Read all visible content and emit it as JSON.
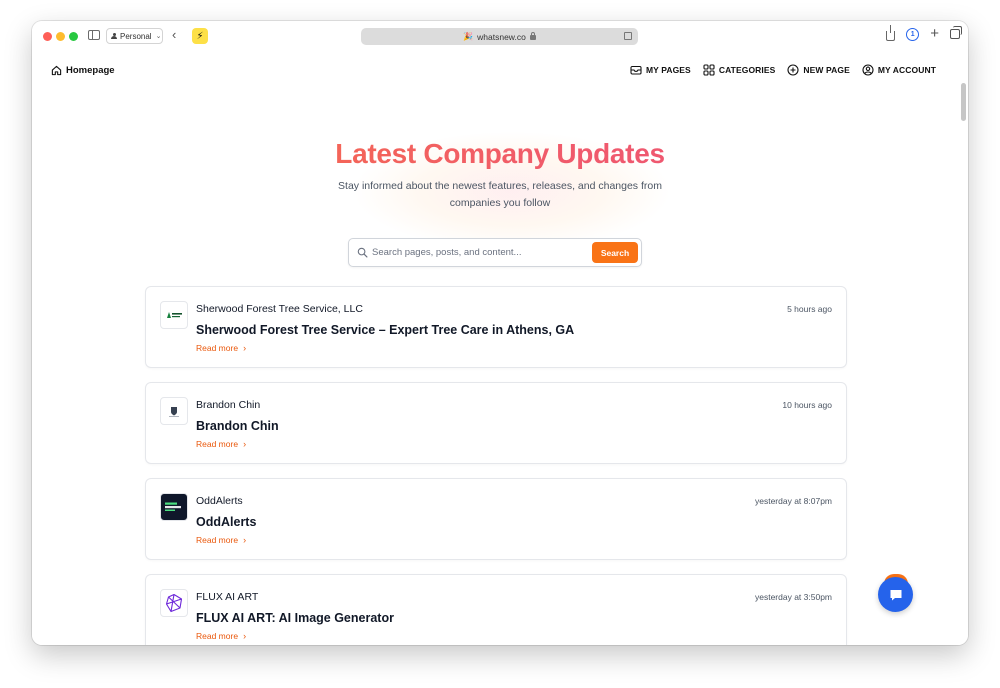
{
  "browser": {
    "profile_label": "Personal",
    "address": "whatsnew.co",
    "colors": {
      "close": "#fe5f57",
      "minimize": "#febc2e",
      "zoom": "#28c840"
    }
  },
  "nav": {
    "home_label": "Homepage",
    "items": [
      {
        "label": "MY PAGES",
        "icon": "inbox-icon"
      },
      {
        "label": "CATEGORIES",
        "icon": "grid-icon"
      },
      {
        "label": "NEW PAGE",
        "icon": "plus-circle-icon"
      },
      {
        "label": "MY ACCOUNT",
        "icon": "user-circle-icon"
      }
    ]
  },
  "hero": {
    "title": "Latest Company Updates",
    "subtitle_line1": "Stay informed about the newest features, releases, and changes from",
    "subtitle_line2": "companies you follow",
    "gradient": [
      "#f97340",
      "#ec4f7e"
    ]
  },
  "search": {
    "placeholder": "Search pages, posts, and content...",
    "button_label": "Search",
    "accent": "#f97316"
  },
  "feed": [
    {
      "company": "Sherwood Forest Tree Service, LLC",
      "time": "5 hours ago",
      "title": "Sherwood Forest Tree Service – Expert Tree Care in Athens, GA",
      "read_more": "Read more",
      "logo": "sherwood-logo"
    },
    {
      "company": "Brandon Chin",
      "time": "10 hours ago",
      "title": "Brandon Chin",
      "read_more": "Read more",
      "logo": "brandon-chin-logo"
    },
    {
      "company": "OddAlerts",
      "time": "yesterday at 8:07pm",
      "title": "OddAlerts",
      "read_more": "Read more",
      "logo": "oddalerts-logo"
    },
    {
      "company": "FLUX AI ART",
      "time": "yesterday at 3:50pm",
      "title": "FLUX AI ART: AI Image Generator",
      "read_more": "Read more",
      "logo": "flux-ai-art-logo"
    }
  ],
  "link_color": "#ea580c",
  "chat_color": "#2563eb"
}
